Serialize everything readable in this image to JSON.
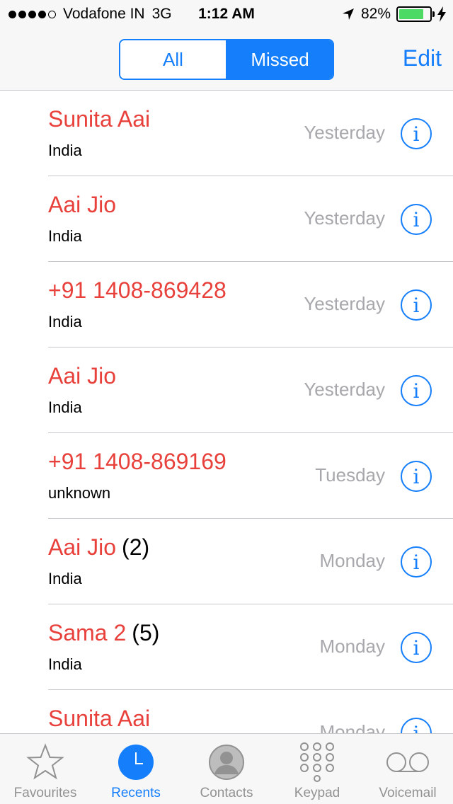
{
  "status_bar": {
    "carrier": "Vodafone IN",
    "network": "3G",
    "time": "1:12 AM",
    "battery_percent": "82%",
    "battery_level": 0.82
  },
  "nav": {
    "segments": [
      "All",
      "Missed"
    ],
    "selected_segment": "Missed",
    "edit_label": "Edit"
  },
  "calls": [
    {
      "name": "Sunita Aai",
      "count": "",
      "sub": "India",
      "date": "Yesterday"
    },
    {
      "name": "Aai Jio",
      "count": "",
      "sub": "India",
      "date": "Yesterday"
    },
    {
      "name": "+91 1408-869428",
      "count": "",
      "sub": "India",
      "date": "Yesterday"
    },
    {
      "name": "Aai Jio",
      "count": "",
      "sub": "India",
      "date": "Yesterday"
    },
    {
      "name": "+91 1408-869169",
      "count": "",
      "sub": "unknown",
      "date": "Tuesday"
    },
    {
      "name": "Aai Jio",
      "count": "(2)",
      "sub": "India",
      "date": "Monday"
    },
    {
      "name": "Sama 2",
      "count": "(5)",
      "sub": "India",
      "date": "Monday"
    },
    {
      "name": "Sunita Aai",
      "count": "",
      "sub": "",
      "date": "Monday"
    }
  ],
  "tabs": [
    {
      "label": "Favourites",
      "icon": "star-icon"
    },
    {
      "label": "Recents",
      "icon": "clock-icon"
    },
    {
      "label": "Contacts",
      "icon": "person-icon"
    },
    {
      "label": "Keypad",
      "icon": "keypad-icon"
    },
    {
      "label": "Voicemail",
      "icon": "voicemail-icon"
    }
  ],
  "active_tab": "Recents",
  "colors": {
    "accent": "#147efb",
    "missed": "#e8413c",
    "battery": "#4cd964"
  }
}
